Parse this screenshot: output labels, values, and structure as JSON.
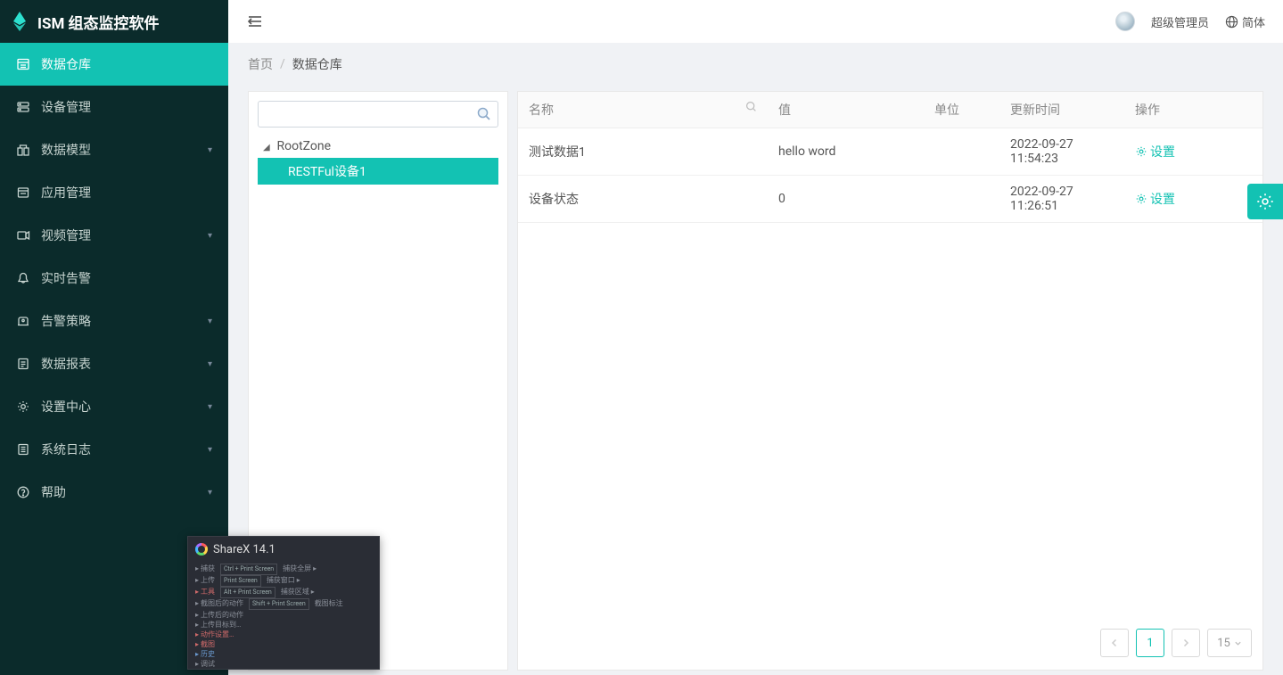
{
  "app_title": "ISM 组态监控软件",
  "header": {
    "user_label": "超级管理员",
    "lang_label": "简体"
  },
  "breadcrumb": {
    "home": "首页",
    "current": "数据仓库"
  },
  "sidebar": {
    "items": [
      {
        "label": "数据仓库",
        "expandable": false,
        "active": true
      },
      {
        "label": "设备管理",
        "expandable": false,
        "active": false
      },
      {
        "label": "数据模型",
        "expandable": true,
        "active": false
      },
      {
        "label": "应用管理",
        "expandable": false,
        "active": false
      },
      {
        "label": "视频管理",
        "expandable": true,
        "active": false
      },
      {
        "label": "实时告警",
        "expandable": false,
        "active": false
      },
      {
        "label": "告警策略",
        "expandable": true,
        "active": false
      },
      {
        "label": "数据报表",
        "expandable": true,
        "active": false
      },
      {
        "label": "设置中心",
        "expandable": true,
        "active": false
      },
      {
        "label": "系统日志",
        "expandable": true,
        "active": false
      },
      {
        "label": "帮助",
        "expandable": true,
        "active": false
      }
    ]
  },
  "tree": {
    "root": "RootZone",
    "child": "RESTFul设备1"
  },
  "table": {
    "columns": {
      "name": "名称",
      "value": "值",
      "unit": "单位",
      "updated": "更新时间",
      "op": "操作"
    },
    "op_label": "设置",
    "rows": [
      {
        "name": "测试数据1",
        "value": "hello word",
        "unit": "",
        "updated": "2022-09-27 11:54:23"
      },
      {
        "name": "设备状态",
        "value": "0",
        "unit": "",
        "updated": "2022-09-27 11:26:51"
      }
    ]
  },
  "pager": {
    "current": "1",
    "page_size": "15"
  },
  "sharex": {
    "title": "ShareX 14.1"
  }
}
